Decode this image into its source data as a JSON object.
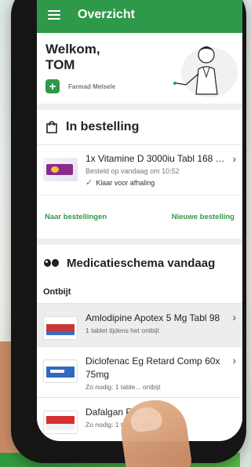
{
  "appbar": {
    "title": "Overzicht"
  },
  "welcome": {
    "greeting": "Welkom,",
    "user": "TOM",
    "pharmacy": "Farmad Melsele"
  },
  "order_section": {
    "title": "In bestelling",
    "item": {
      "title": "1x Vitamine D 3000iu Tabl 168 Me...",
      "ordered": "Besteld op vandaag om 10:52",
      "status": "Klaar voor afhaling"
    },
    "link_orders": "Naar bestellingen",
    "link_new": "Nieuwe bestelling"
  },
  "schedule_section": {
    "title": "Medicatieschema vandaag",
    "meal": "Ontbijt",
    "items": [
      {
        "title": "Amlodipine Apotex 5 Mg Tabl 98",
        "sub": "1 tablet tijdens het ontbijt"
      },
      {
        "title": "Diclofenac Eg Retard Comp 60x 75mg",
        "sub": "Zo nodig: 1 table... ontbijt"
      },
      {
        "title": "Dafalgan Fo... 40",
        "sub": "Zo nodig: 1 tablet na h..."
      }
    ]
  },
  "colors": {
    "accent": "#2e9a49"
  }
}
